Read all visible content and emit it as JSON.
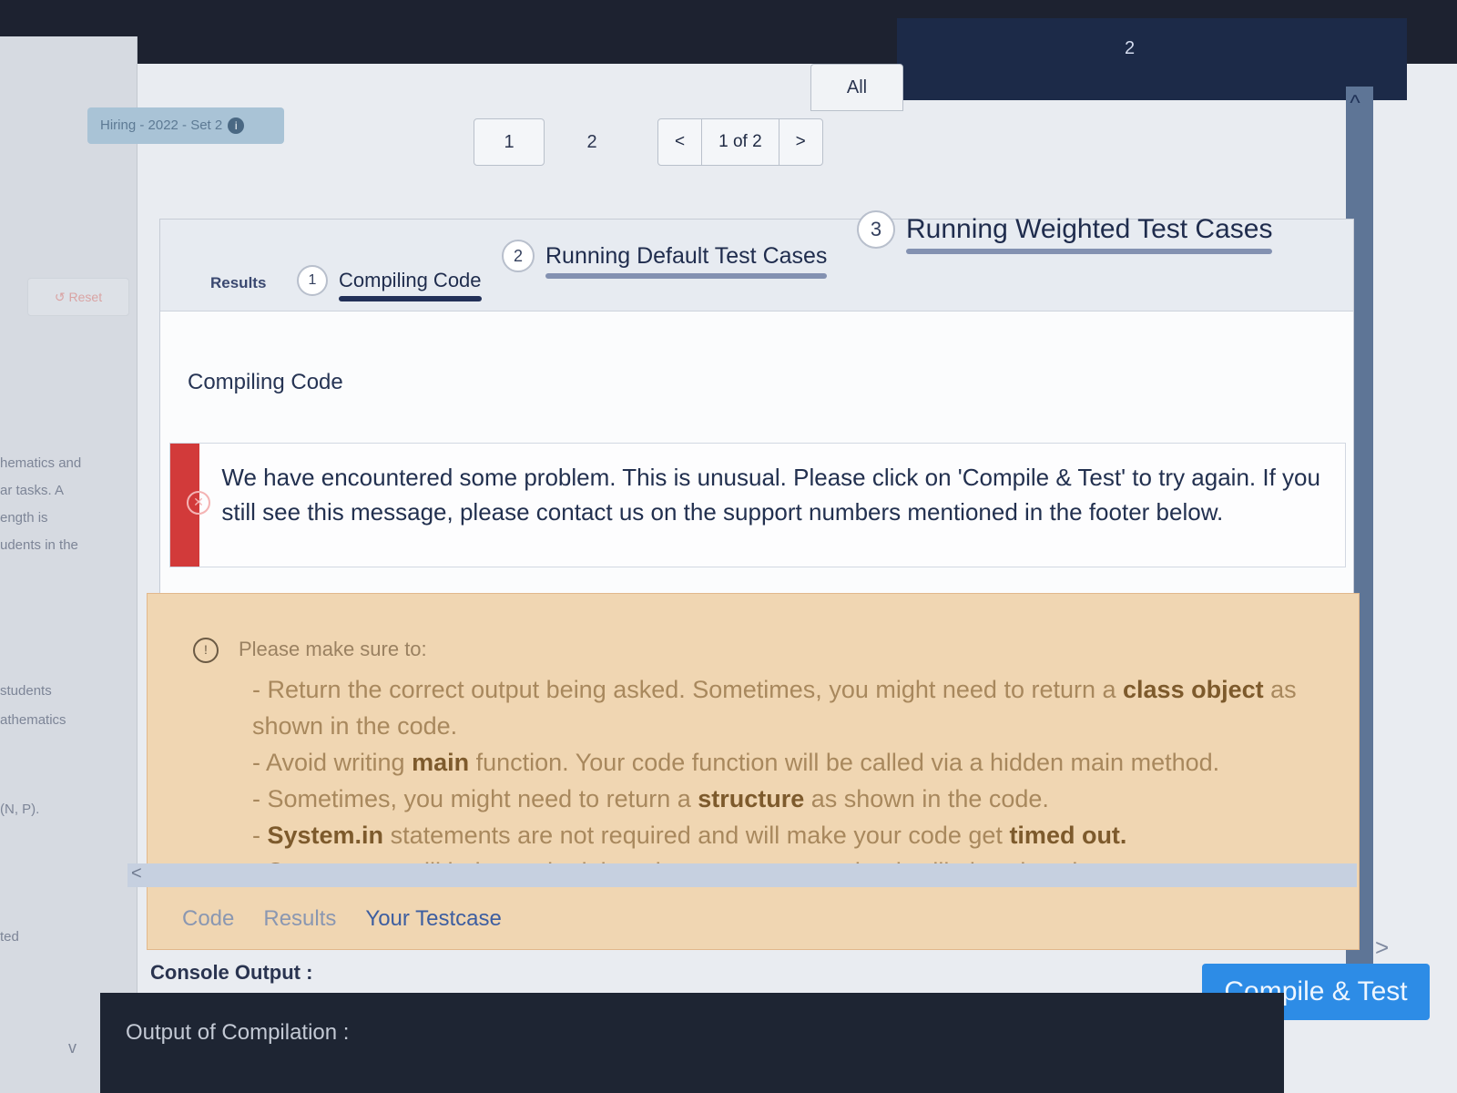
{
  "header": {
    "set_label": "Hiring - 2022 - Set 2",
    "set_info_icon": "info-icon",
    "reset_label": "Reset",
    "counter_value": "2"
  },
  "left_rail": {
    "snippets": [
      "hematics and",
      "ar tasks. A",
      "ength is",
      "udents in the",
      "students",
      "athematics",
      "(N, P).",
      "ted"
    ]
  },
  "pagination": {
    "page_1": "1",
    "page_2": "2",
    "prev": "<",
    "position": "1 of 2",
    "next": ">",
    "all_label": "All"
  },
  "results": {
    "tab_label": "Results",
    "steps": [
      {
        "num": "1",
        "label": "Compiling Code"
      },
      {
        "num": "2",
        "label": "Running Default Test Cases"
      },
      {
        "num": "3",
        "label": "Running Weighted Test Cases"
      }
    ],
    "section_title": "Compiling Code",
    "error_message": "We have encountered some problem. This is unusual. Please click on 'Compile & Test' to try again. If you still see this message, please contact us on the support numbers mentioned in the footer below.",
    "warning": {
      "heading": "Please make sure to:",
      "line1_pre": "- Return the correct output being asked. Sometimes, you might need to return a ",
      "line1_bold": "class object",
      "line1_post": " as shown in the code.",
      "line2_pre": "- Avoid writing ",
      "line2_bold": "main",
      "line2_post": " function. Your code function will be called via a hidden main method.",
      "line3_pre": "- Sometimes, you might need to return a ",
      "line3_bold": "structure",
      "line3_post": " as shown in the code.",
      "line4_bold": "System.in",
      "line4_mid": " statements are not required and will make your code get ",
      "line4_bold2": "timed out.",
      "line5_bold": "System.out",
      "line5_post": " will help you in debugging your program, but it will also slow down your program"
    }
  },
  "bottom": {
    "tabs": [
      "Code",
      "Results",
      "Your Testcase"
    ],
    "console_label": "Console Output :",
    "compile_button": "Compile & Test",
    "output_label": "Output of Compilation :"
  }
}
